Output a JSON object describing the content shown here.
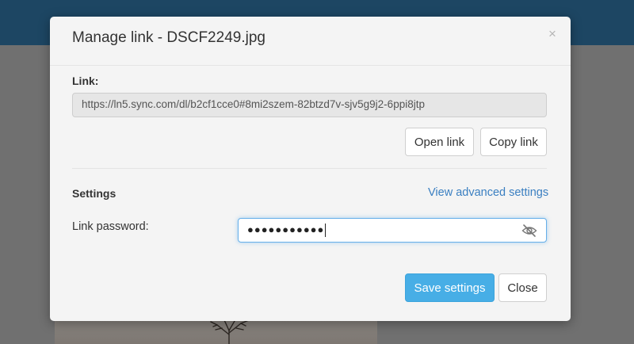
{
  "dialog": {
    "title": "Manage link - DSCF2249.jpg",
    "close_icon": "close-icon"
  },
  "link": {
    "label": "Link:",
    "url": "https://ln5.sync.com/dl/b2cf1cce0#8mi2szem-82btzd7v-sjv5g9j2-6ppi8jtp",
    "open_label": "Open link",
    "copy_label": "Copy link"
  },
  "settings": {
    "label": "Settings",
    "advanced_link": "View advanced settings",
    "password_label": "Link password:",
    "password_masked": "●●●●●●●●●●●",
    "password_toggle_icon": "eye-slash-icon"
  },
  "footer": {
    "save_label": "Save settings",
    "close_label": "Close"
  },
  "colors": {
    "primary": "#47aee6",
    "link": "#3a7fc1",
    "header_bar": "#1d4663",
    "focus_ring": "#66afe9"
  }
}
